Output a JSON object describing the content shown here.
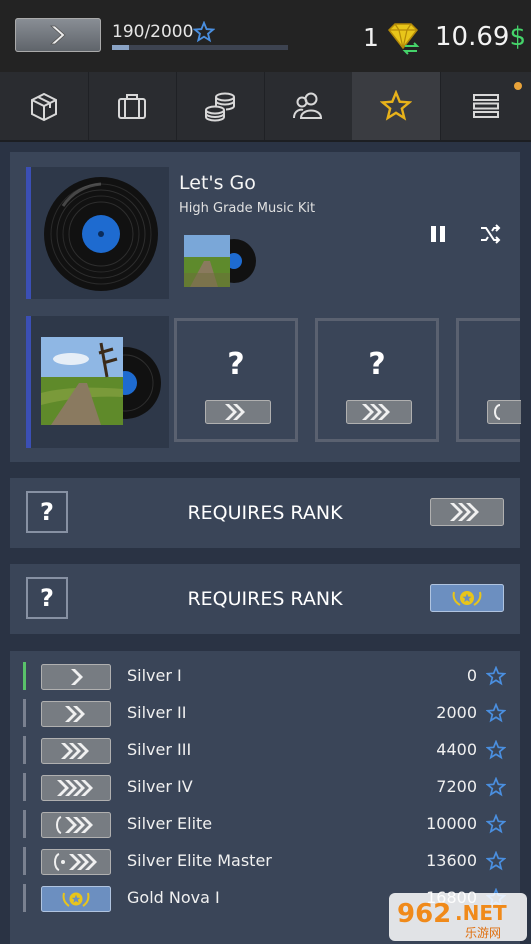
{
  "header": {
    "xp_text": "190/2000",
    "xp_progress": 0.095,
    "gem_count": "1",
    "balance": "10.69",
    "currency": "$"
  },
  "nav": {
    "items": [
      "inventory-icon",
      "case-icon",
      "coins-icon",
      "friends-icon",
      "star-icon",
      "menu-icon"
    ],
    "active": "star-icon"
  },
  "music": {
    "title": "Let's Go",
    "subtitle": "High Grade Music Kit"
  },
  "locked_slots": [
    {
      "symbol": "?"
    },
    {
      "symbol": "?"
    }
  ],
  "requirements": [
    {
      "symbol": "?",
      "label": "REQUIRES RANK"
    },
    {
      "symbol": "?",
      "label": "REQUIRES RANK"
    }
  ],
  "ranks": [
    {
      "name": "Silver I",
      "points": "0"
    },
    {
      "name": "Silver II",
      "points": "2000"
    },
    {
      "name": "Silver III",
      "points": "4400"
    },
    {
      "name": "Silver IV",
      "points": "7200"
    },
    {
      "name": "Silver Elite",
      "points": "10000"
    },
    {
      "name": "Silver Elite Master",
      "points": "13600"
    },
    {
      "name": "Gold Nova I",
      "points": "16800"
    }
  ],
  "watermark": {
    "brand": "962",
    "suffix": ".NET",
    "sub": "乐游网"
  },
  "colors": {
    "accent_blue": "#3b4fb5",
    "money_green": "#45d36a",
    "gold": "#e8c51a",
    "star_blue": "#4a8fe0",
    "current_rank": "#59c26a"
  }
}
